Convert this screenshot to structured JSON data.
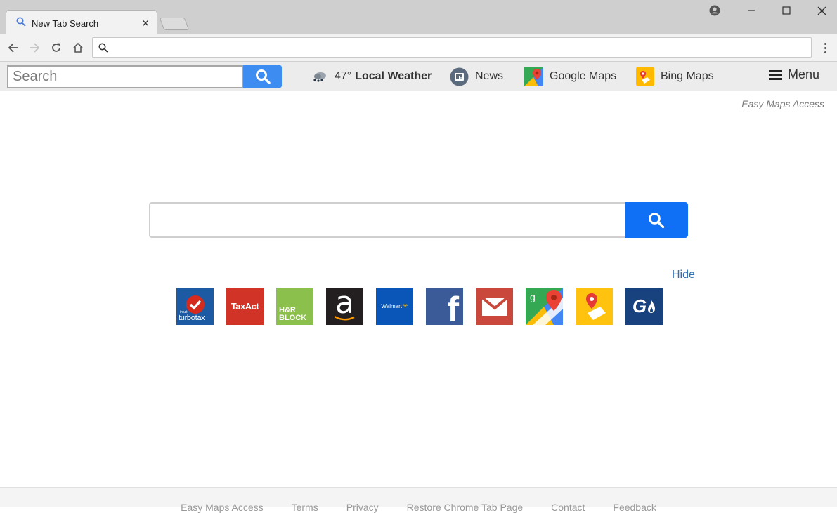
{
  "browser": {
    "tab_title": "New Tab Search",
    "tab_close": "✕",
    "address_value": "",
    "address_placeholder": ""
  },
  "extension_bar": {
    "search_placeholder": "Search",
    "weather_temp": "47°",
    "weather_label": "Local Weather",
    "news_label": "News",
    "google_maps_label": "Google Maps",
    "bing_maps_label": "Bing Maps",
    "menu_label": "Menu"
  },
  "page": {
    "brand": "Easy Maps Access",
    "search_value": "",
    "hide_label": "Hide",
    "tiles": [
      {
        "name": "turbotax",
        "label": "turbotax",
        "sublabel": "intuit",
        "bg": "#1c5aa4"
      },
      {
        "name": "taxact",
        "label": "TaxAct",
        "bg": "#d13327"
      },
      {
        "name": "hr-block",
        "label": "H&R BLOCK",
        "bg": "#8cc04d"
      },
      {
        "name": "amazon",
        "label": "a",
        "bg": "#231f20"
      },
      {
        "name": "walmart",
        "label": "Walmart",
        "bg": "#0a55b8"
      },
      {
        "name": "facebook",
        "label": "f",
        "bg": "#3a5a98"
      },
      {
        "name": "gmail",
        "label": "",
        "bg": "#c9473b"
      },
      {
        "name": "google-maps",
        "label": "",
        "bg": "#ffffff"
      },
      {
        "name": "bing-maps",
        "label": "",
        "bg": "#ffc30f"
      },
      {
        "name": "g-search",
        "label": "G",
        "bg": "#17427e"
      }
    ]
  },
  "footer": {
    "links": [
      "Easy Maps Access",
      "Terms",
      "Privacy",
      "Restore Chrome Tab Page",
      "Contact",
      "Feedback"
    ]
  },
  "colors": {
    "accent_button": "#0f6ff5",
    "ext_button": "#3c8cf2",
    "link": "#2e6eb5"
  }
}
